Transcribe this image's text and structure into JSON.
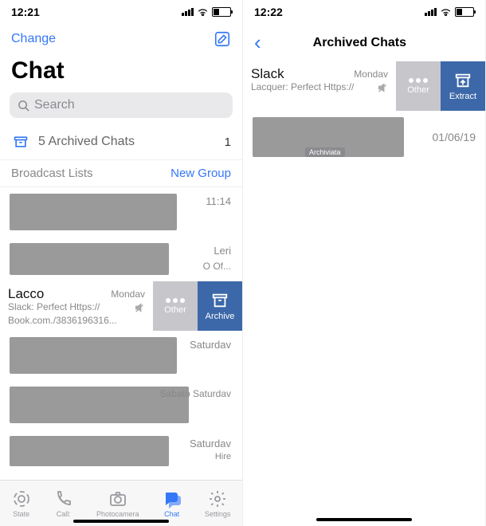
{
  "left": {
    "status": {
      "time": "12:21"
    },
    "nav": {
      "edit_label": "Change"
    },
    "title": "Chat",
    "search": {
      "placeholder": "Search"
    },
    "archived": {
      "label": "5 Archived Chats",
      "count": "1"
    },
    "lists": {
      "broadcast": "Broadcast Lists",
      "new_group": "New Group"
    },
    "rows": [
      {
        "time": "11:14"
      },
      {
        "time": "Leri",
        "sub": "O Of..."
      },
      {
        "swipe": true,
        "name": "Lacco",
        "time": "Mondav",
        "preview1": "Slack: Perfect Https://",
        "preview2": "Book.com./3836196316...",
        "action_other": "Other",
        "action_archive": "Archive"
      },
      {
        "time": "Saturdav"
      },
      {
        "time": "Sabato Saturdav"
      },
      {
        "time": "Saturdav",
        "sub": "Hire"
      }
    ],
    "tabs": {
      "items": [
        {
          "label": "State"
        },
        {
          "label": "Call:"
        },
        {
          "label": "Photocamera"
        },
        {
          "label": "Chat"
        },
        {
          "label": "Settings"
        }
      ]
    }
  },
  "right": {
    "status": {
      "time": "12:22"
    },
    "header": {
      "title": "Archived Chats"
    },
    "swiped": {
      "name": "Slack",
      "time": "Mondav",
      "preview": "Lacquer: Perfect Https://",
      "action_other": "Other",
      "action_extract": "Extract"
    },
    "row": {
      "date": "01/06/19",
      "badge": "Archiviata"
    }
  }
}
